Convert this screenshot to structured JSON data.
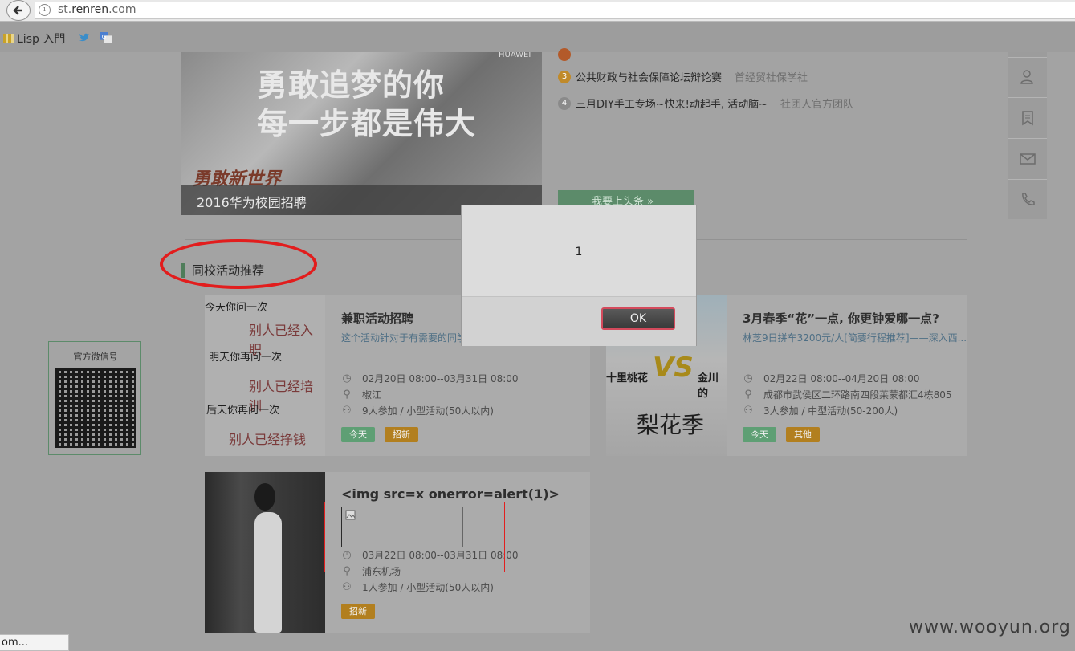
{
  "browser": {
    "url_host": "st.",
    "url_domain": "renren",
    "url_tld": ".com",
    "bookmarks": [
      {
        "label": "Lisp 入門"
      }
    ],
    "status_text": "om..."
  },
  "banner": {
    "headline1": "勇敢追梦的你",
    "headline2": "每一步都是伟大",
    "brand": "勇敢新世界",
    "logo": "HUAWEI",
    "caption": "2016华为校园招聘"
  },
  "news": [
    {
      "num": "3",
      "title": "公共财政与社会保障论坛辩论赛",
      "source": "首经贸社保学社"
    },
    {
      "num": "4",
      "title": "三月DIY手工专场~快来!动起手, 活动脑~",
      "source": "社团人官方团队"
    }
  ],
  "toutiao_label": "我要上头条 »",
  "section_title": "同校活动推荐",
  "qr_title": "官方微信号",
  "cards": [
    {
      "title": "兼职活动招聘",
      "desc": "这个活动针对于有需要的同学",
      "time": "02月20日 08:00--03月31日 08:00",
      "place": "椒江",
      "people": "9人参加 / 小型活动(50人以内)",
      "tags": [
        "今天",
        "招新"
      ],
      "img_lines": [
        "今天你问一次",
        "别人已经入职",
        "明天你再问一次",
        "别人已经培训",
        "后天你再问一次",
        "别人已经挣钱"
      ]
    },
    {
      "title": "3月春季“花”一点, 你更钟爱哪一点?",
      "desc": "林芝9日拼车3200元/人[简要行程推荐]——深入西...",
      "time": "02月22日 08:00--04月20日 08:00",
      "place": "成都市武侯区二环路南四段莱蒙都汇4栋805",
      "people": "3人参加 / 中型活动(50-200人)",
      "tags": [
        "今天",
        "其他"
      ],
      "img_lines": [
        "十里桃花",
        "VS",
        "金川的",
        "梨花季"
      ]
    },
    {
      "title": "<img src=x onerror=alert(1)>",
      "time": "03月22日 08:00--03月31日 08:00",
      "place": "浦东机场",
      "people": "1人参加 / 小型活动(50人以内)",
      "tags": [
        "招新"
      ]
    }
  ],
  "dialog": {
    "message": "1",
    "ok_label": "OK"
  },
  "watermark": "www.wooyun.org"
}
